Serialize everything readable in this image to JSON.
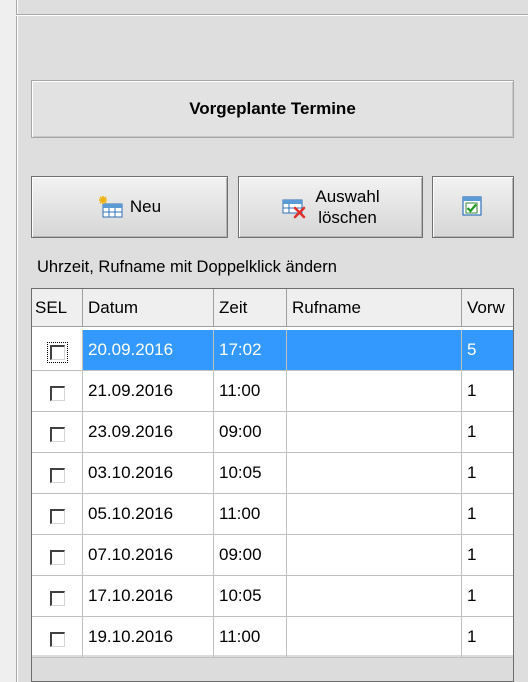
{
  "panel": {
    "title": "Vorgeplante Termine"
  },
  "toolbar": {
    "new_label": "Neu",
    "delete_label_line1": "Auswahl",
    "delete_label_line2": "löschen",
    "select_all_icon": "checklist-icon",
    "new_icon": "new-table-icon",
    "delete_icon": "delete-table-icon"
  },
  "hint": "Uhrzeit, Rufname mit Doppelklick ändern",
  "table": {
    "columns": [
      "SEL",
      "Datum",
      "Zeit",
      "Rufname",
      "Vorw"
    ],
    "rows": [
      {
        "sel": false,
        "datum": "20.09.2016",
        "zeit": "17:02",
        "rufname": "",
        "vorw": "5",
        "selected": true
      },
      {
        "sel": false,
        "datum": "21.09.2016",
        "zeit": "11:00",
        "rufname": "",
        "vorw": "1",
        "selected": false
      },
      {
        "sel": false,
        "datum": "23.09.2016",
        "zeit": "09:00",
        "rufname": "",
        "vorw": "1",
        "selected": false
      },
      {
        "sel": false,
        "datum": "03.10.2016",
        "zeit": "10:05",
        "rufname": "",
        "vorw": "1",
        "selected": false
      },
      {
        "sel": false,
        "datum": "05.10.2016",
        "zeit": "11:00",
        "rufname": "",
        "vorw": "1",
        "selected": false
      },
      {
        "sel": false,
        "datum": "07.10.2016",
        "zeit": "09:00",
        "rufname": "",
        "vorw": "1",
        "selected": false
      },
      {
        "sel": false,
        "datum": "17.10.2016",
        "zeit": "10:05",
        "rufname": "",
        "vorw": "1",
        "selected": false
      },
      {
        "sel": false,
        "datum": "19.10.2016",
        "zeit": "11:00",
        "rufname": "",
        "vorw": "1",
        "selected": false
      }
    ]
  },
  "colors": {
    "selection": "#3399ff",
    "panel_bg": "#dedede"
  }
}
